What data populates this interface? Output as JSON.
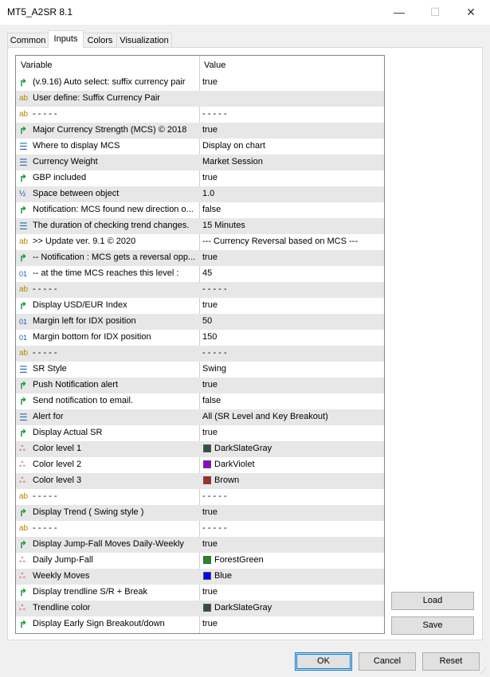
{
  "window": {
    "title": "MT5_A2SR 8.1",
    "minimize_glyph": "—",
    "maximize_glyph": "☐",
    "close_glyph": "✕"
  },
  "tabs": [
    {
      "label": "Common",
      "active": false
    },
    {
      "label": "Inputs",
      "active": true
    },
    {
      "label": "Colors",
      "active": false
    },
    {
      "label": "Visualization",
      "active": false
    }
  ],
  "grid": {
    "header_variable": "Variable",
    "header_value": "Value",
    "rows": [
      {
        "type": "bool",
        "variable": "(v.9.16) Auto select: suffix currency pair",
        "value": "true"
      },
      {
        "type": "str",
        "variable": "User define: Suffix Currency Pair",
        "value": ""
      },
      {
        "type": "str",
        "variable": "- - - - -",
        "value": "- - - - -"
      },
      {
        "type": "bool",
        "variable": "Major Currency Strength (MCS) © 2018",
        "value": "true"
      },
      {
        "type": "enum",
        "variable": "Where to display MCS",
        "value": "Display on chart"
      },
      {
        "type": "enum",
        "variable": "Currency Weight",
        "value": "Market Session"
      },
      {
        "type": "bool",
        "variable": "GBP included",
        "value": "true"
      },
      {
        "type": "dbl",
        "variable": "Space between object",
        "value": "1.0"
      },
      {
        "type": "bool",
        "variable": "Notification: MCS found new direction o...",
        "value": "false"
      },
      {
        "type": "enum",
        "variable": "The duration of checking trend changes.",
        "value": "15 Minutes"
      },
      {
        "type": "str",
        "variable": ">> Update ver. 9.1 © 2020",
        "value": "--- Currency Reversal based on MCS ---"
      },
      {
        "type": "bool",
        "variable": "-- Notification : MCS gets a reversal opp...",
        "value": "true"
      },
      {
        "type": "int",
        "variable": "-- at the time MCS reaches this level :",
        "value": "45"
      },
      {
        "type": "str",
        "variable": "- - - - -",
        "value": "- - - - -"
      },
      {
        "type": "bool",
        "variable": "Display USD/EUR Index",
        "value": "true"
      },
      {
        "type": "int",
        "variable": "Margin left for IDX position",
        "value": "50"
      },
      {
        "type": "int",
        "variable": "Margin bottom for IDX position",
        "value": "150"
      },
      {
        "type": "str",
        "variable": "- - - - -",
        "value": "- - - - -"
      },
      {
        "type": "enum",
        "variable": "SR Style",
        "value": "Swing"
      },
      {
        "type": "bool",
        "variable": "Push Notification alert",
        "value": "true"
      },
      {
        "type": "bool",
        "variable": "Send notification to email.",
        "value": "false"
      },
      {
        "type": "enum",
        "variable": "Alert for",
        "value": "All (SR Level and Key Breakout)"
      },
      {
        "type": "bool",
        "variable": "Display Actual SR",
        "value": "true"
      },
      {
        "type": "color",
        "variable": "Color level 1",
        "value": "DarkSlateGray",
        "swatch": "#2f4f4f"
      },
      {
        "type": "color",
        "variable": "Color level 2",
        "value": "DarkViolet",
        "swatch": "#9400d3"
      },
      {
        "type": "color",
        "variable": "Color level 3",
        "value": "Brown",
        "swatch": "#a52a2a"
      },
      {
        "type": "str",
        "variable": "- - - - -",
        "value": "- - - - -"
      },
      {
        "type": "bool",
        "variable": "Display Trend ( Swing style )",
        "value": "true"
      },
      {
        "type": "str",
        "variable": "- - - - -",
        "value": "- - - - -"
      },
      {
        "type": "bool",
        "variable": "Display Jump-Fall Moves Daily-Weekly",
        "value": "true"
      },
      {
        "type": "color",
        "variable": "Daily Jump-Fall",
        "value": "ForestGreen",
        "swatch": "#228b22"
      },
      {
        "type": "color",
        "variable": "Weekly Moves",
        "value": "Blue",
        "swatch": "#0000ff"
      },
      {
        "type": "bool",
        "variable": "Display trendline S/R + Break",
        "value": "true"
      },
      {
        "type": "color",
        "variable": "Trendline color",
        "value": "DarkSlateGray",
        "swatch": "#2f4f4f"
      },
      {
        "type": "bool",
        "variable": "Display Early Sign Breakout/down",
        "value": "true"
      }
    ]
  },
  "icons": {
    "bool": {
      "name": "bool-type-icon",
      "glyph": "↱"
    },
    "str": {
      "name": "string-type-icon",
      "glyph": "ab"
    },
    "enum": {
      "name": "enum-type-icon",
      "glyph": "☰"
    },
    "dbl": {
      "name": "double-type-icon",
      "glyph": "½"
    },
    "int": {
      "name": "integer-type-icon",
      "glyph": "01"
    },
    "color": {
      "name": "color-type-icon",
      "glyph": "ஃ"
    }
  },
  "side_buttons": {
    "load": "Load",
    "save": "Save"
  },
  "footer_buttons": {
    "ok": "OK",
    "cancel": "Cancel",
    "reset": "Reset"
  }
}
